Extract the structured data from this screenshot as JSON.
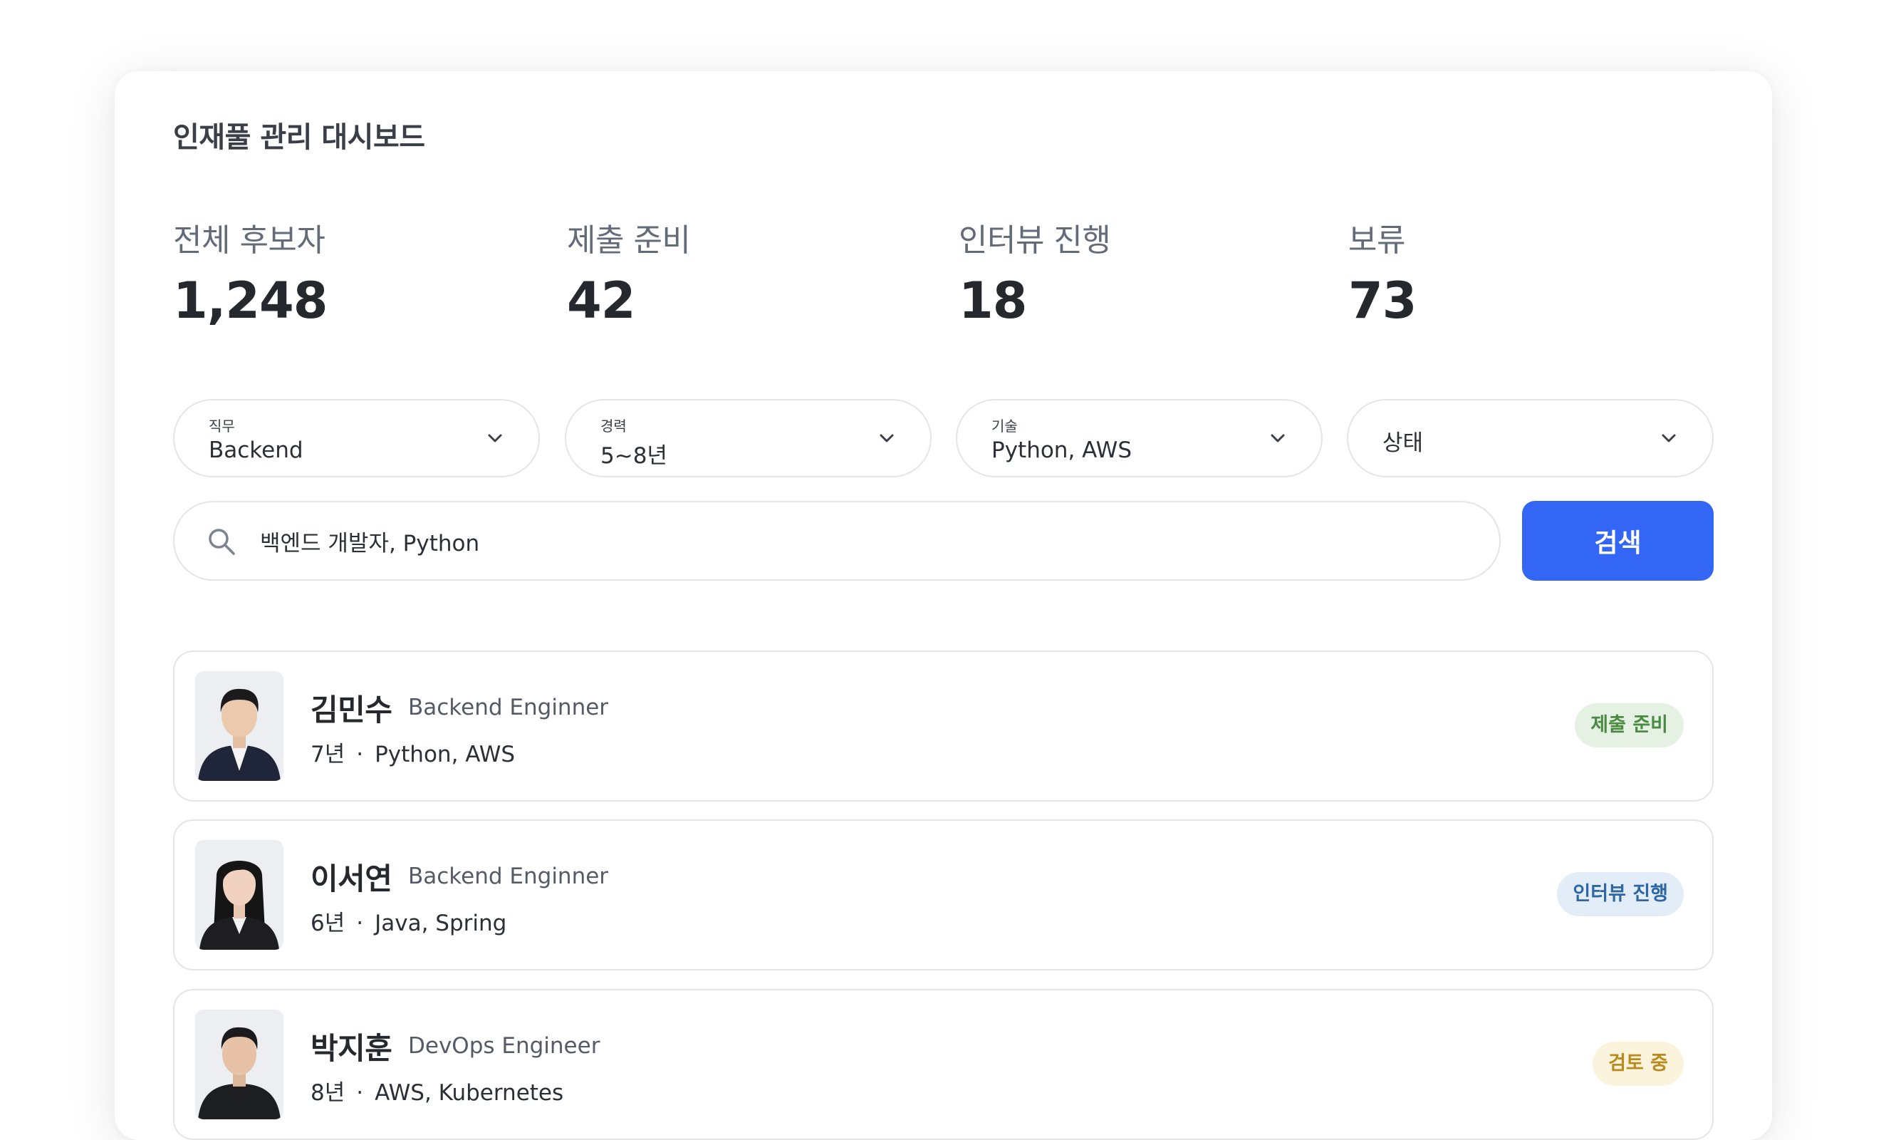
{
  "title": "인재풀 관리 대시보드",
  "stats": [
    {
      "label": "전체 후보자",
      "value": "1,248"
    },
    {
      "label": "제출 준비",
      "value": "42"
    },
    {
      "label": "인터뷰 진행",
      "value": "18"
    },
    {
      "label": "보류",
      "value": "73"
    }
  ],
  "filters": [
    {
      "label": "직무",
      "value": "Backend"
    },
    {
      "label": "경력",
      "value": "5~8년"
    },
    {
      "label": "기술",
      "value": "Python, AWS"
    },
    {
      "label": "",
      "value": "상태"
    }
  ],
  "search": {
    "value": "백엔드 개발자, Python",
    "button_label": "검색"
  },
  "candidates": [
    {
      "name": "김민수",
      "role": "Backend Enginner",
      "years": "7년",
      "separator": "·",
      "skills": "Python, AWS",
      "status": "제출 준비",
      "status_color": "#4a8a42"
    },
    {
      "name": "이서연",
      "role": "Backend Enginner",
      "years": "6년",
      "separator": "·",
      "skills": "Java, Spring",
      "status": "인터뷰 진행",
      "status_color": "#2f66a6"
    },
    {
      "name": "박지훈",
      "role": "DevOps Engineer",
      "years": "8년",
      "separator": "·",
      "skills": "AWS, Kubernetes",
      "status": "검토 중",
      "status_color": "#b98b1e"
    }
  ],
  "colors": {
    "primary": "#3366f5",
    "border": "#e3e5e9"
  }
}
